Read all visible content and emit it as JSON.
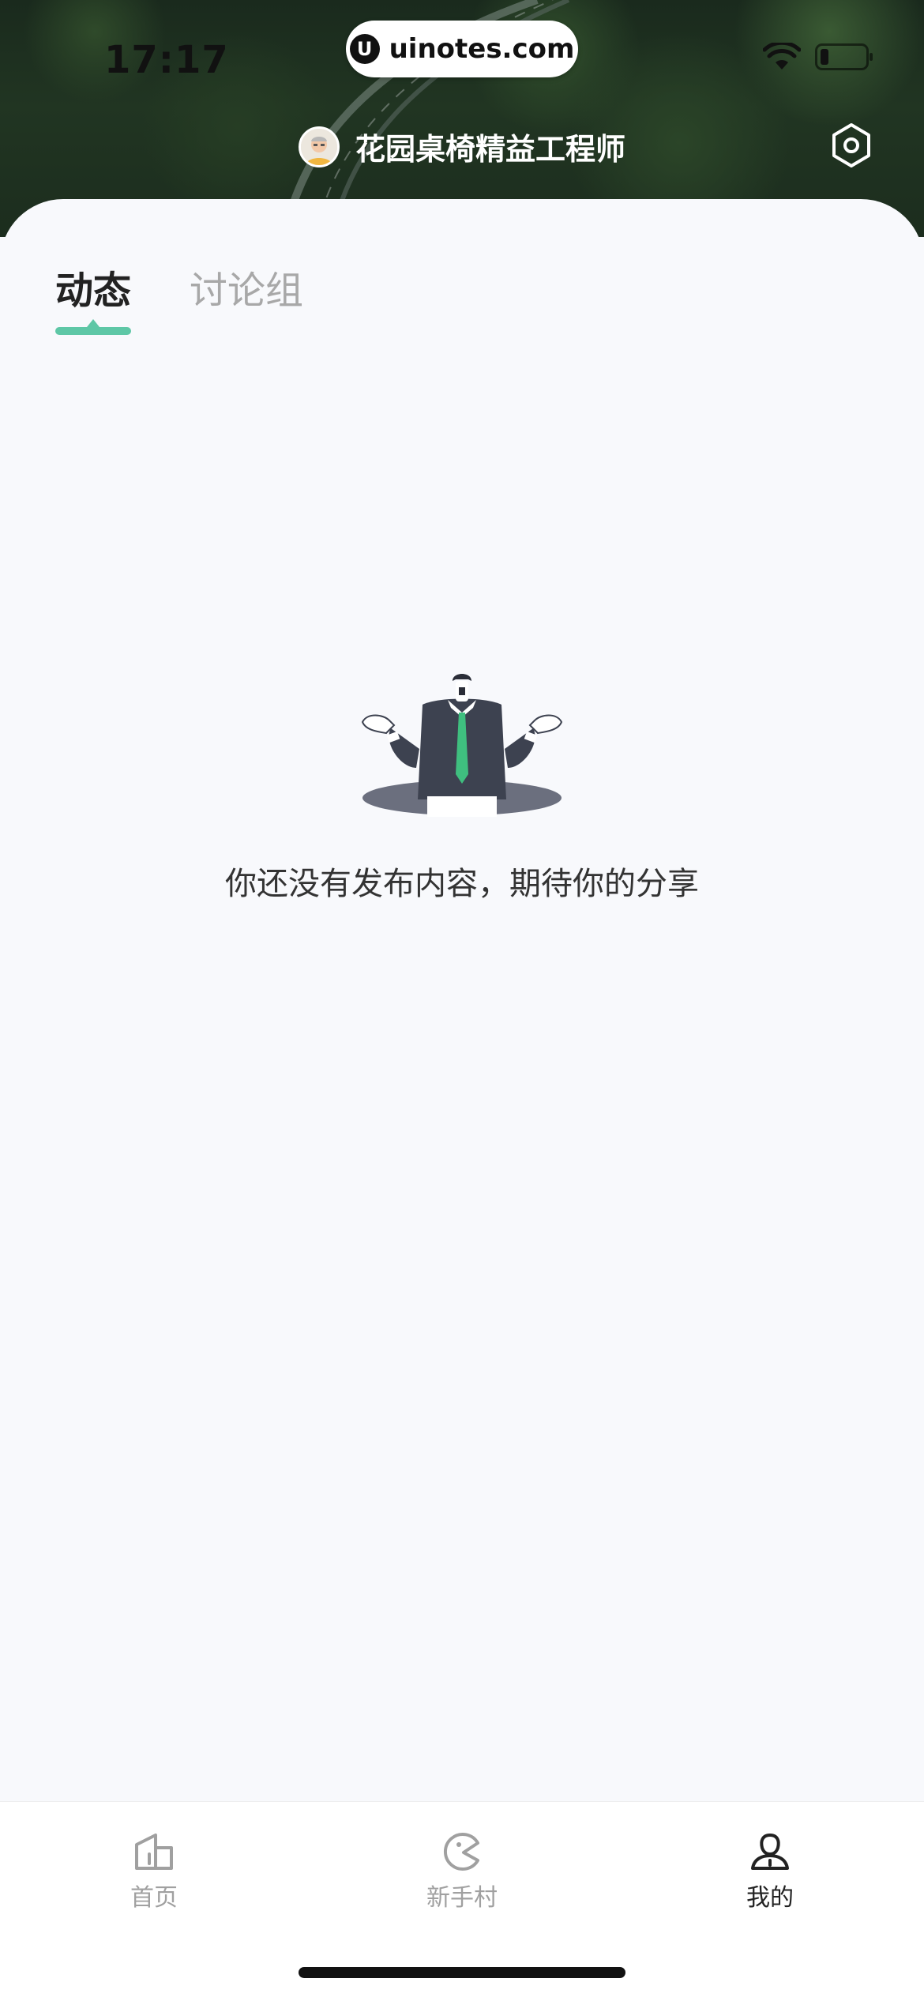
{
  "status_bar": {
    "time": "17:17",
    "url": "uinotes.com",
    "url_logo": "U"
  },
  "header": {
    "username": "花园桌椅精益工程师",
    "settings_icon": "hexagon-settings-icon"
  },
  "tabs": [
    {
      "label": "动态",
      "active": true
    },
    {
      "label": "讨论组",
      "active": false
    }
  ],
  "empty_state": {
    "message": "你还没有发布内容，期待你的分享",
    "illustration": "shrugging-man-in-hole"
  },
  "tab_bar": [
    {
      "label": "首页",
      "icon": "home-icon",
      "active": false
    },
    {
      "label": "新手村",
      "icon": "pacman-icon",
      "active": false
    },
    {
      "label": "我的",
      "icon": "user-icon",
      "active": true
    }
  ],
  "colors": {
    "accent": "#5ec7a6",
    "tie": "#3fbf7f",
    "suit": "#3d4250"
  }
}
